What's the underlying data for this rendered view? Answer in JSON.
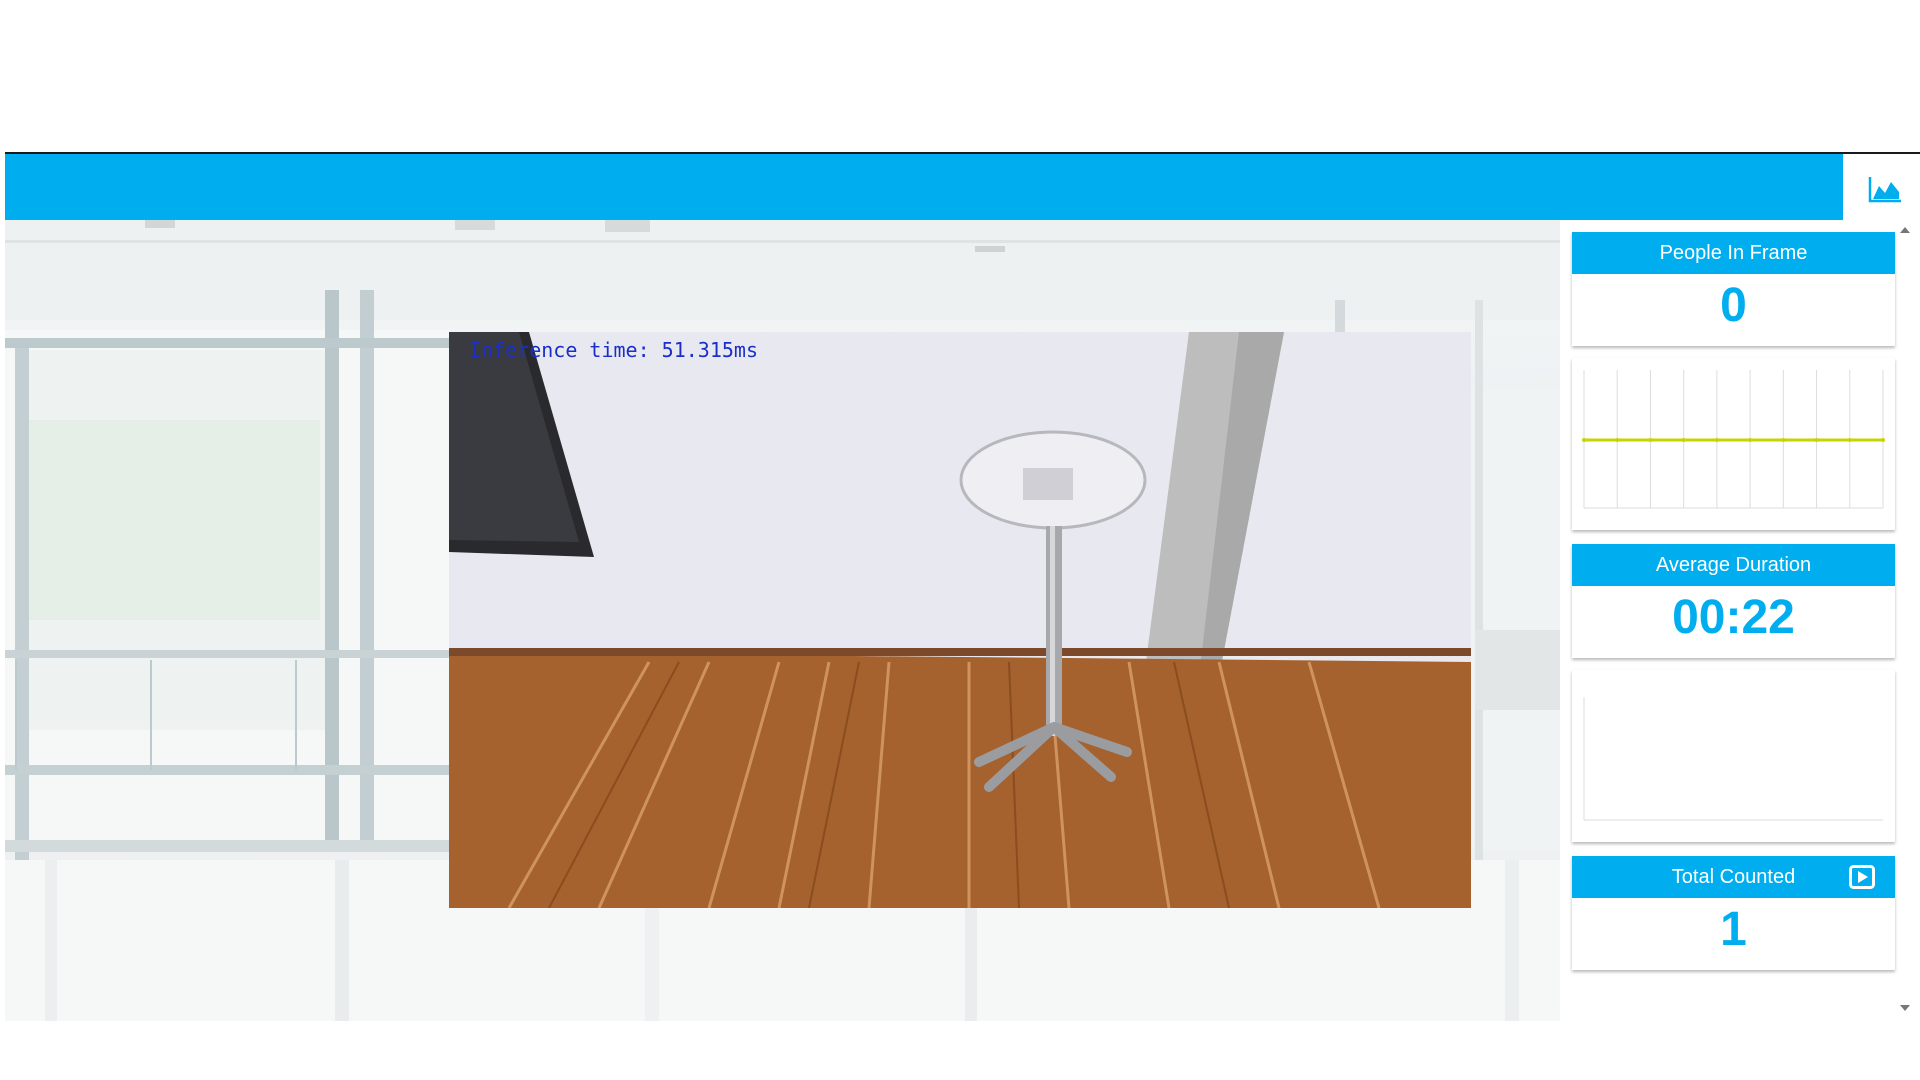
{
  "header": {
    "stats_icon": "area-chart-icon"
  },
  "video": {
    "overlay_text": "Inference time: 51.315ms"
  },
  "stats": {
    "people_in_frame": {
      "title": "People In Frame",
      "value": "0"
    },
    "average_duration": {
      "title": "Average Duration",
      "value": "00:22"
    },
    "total_counted": {
      "title": "Total Counted",
      "value": "1",
      "icon": "play-square-icon"
    }
  },
  "colors": {
    "accent": "#00aeef",
    "chart_line": "#c8d400",
    "overlay_text": "#1a2fc8"
  },
  "chart_data": [
    {
      "type": "line",
      "series": [
        {
          "values": [
            0,
            0,
            0,
            0,
            0,
            0,
            0,
            0,
            0,
            0
          ]
        }
      ],
      "grid": true
    },
    {
      "type": "line",
      "series": [
        {
          "values": []
        }
      ],
      "grid": false
    }
  ]
}
